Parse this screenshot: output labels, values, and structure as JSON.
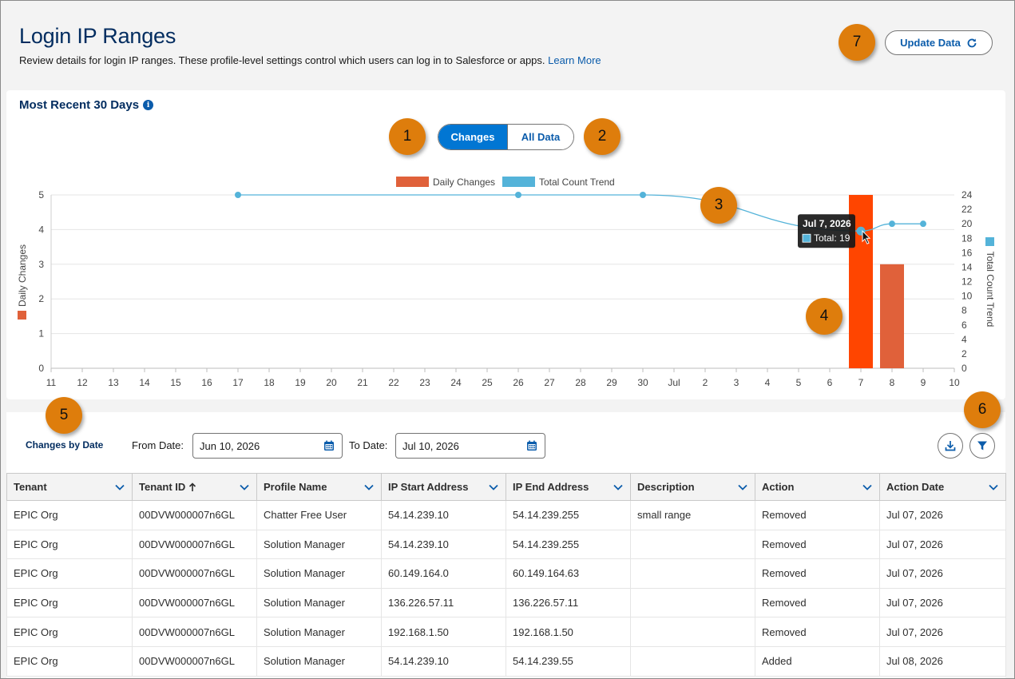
{
  "header": {
    "title": "Login IP Ranges",
    "description": "Review details for login IP ranges. These profile-level settings control which users can log in to Salesforce or apps.",
    "learn_more": "Learn More",
    "update_button": "Update Data"
  },
  "callouts": [
    "1",
    "2",
    "3",
    "4",
    "5",
    "6",
    "7"
  ],
  "chart_card": {
    "title": "Most Recent 30 Days",
    "toggle": {
      "active": "Changes",
      "inactive": "All Data"
    }
  },
  "chart_data": {
    "type": "bar",
    "title": "",
    "categories": [
      "11",
      "12",
      "13",
      "14",
      "15",
      "16",
      "17",
      "18",
      "19",
      "20",
      "21",
      "22",
      "23",
      "24",
      "25",
      "26",
      "27",
      "28",
      "29",
      "30",
      "Jul",
      "2",
      "3",
      "4",
      "5",
      "6",
      "7",
      "8",
      "9",
      "10"
    ],
    "series": [
      {
        "name": "Daily Changes",
        "kind": "bar",
        "axis": "left",
        "color": "#e0613a",
        "values": [
          0,
          0,
          0,
          0,
          0,
          0,
          0,
          0,
          0,
          0,
          0,
          0,
          0,
          0,
          0,
          0,
          0,
          0,
          0,
          0,
          0,
          0,
          0,
          0,
          0,
          0,
          5,
          3,
          0,
          0
        ]
      },
      {
        "name": "Total Count Trend",
        "kind": "line",
        "axis": "right",
        "color": "#54b3d9",
        "points": [
          {
            "x": "17",
            "y": 24
          },
          {
            "x": "26",
            "y": 24
          },
          {
            "x": "30",
            "y": 24
          },
          {
            "x": "7",
            "y": 19
          },
          {
            "x": "8",
            "y": 20
          },
          {
            "x": "9",
            "y": 20
          }
        ]
      }
    ],
    "highlight_bar_color": "#ff4500",
    "ylabel": "Daily Changes",
    "y2label": "Total Count Trend",
    "ylim": [
      0,
      5
    ],
    "y_ticks": [
      "0",
      "1",
      "2",
      "3",
      "4",
      "5"
    ],
    "y2lim": [
      0,
      24
    ],
    "y2_ticks": [
      "0",
      "2",
      "4",
      "6",
      "8",
      "10",
      "12",
      "14",
      "16",
      "18",
      "20",
      "22",
      "24"
    ],
    "legend": [
      "Daily Changes",
      "Total Count Trend"
    ],
    "legend_position": "top-center",
    "grid": true,
    "tooltip": {
      "date": "Jul 7, 2026",
      "label": "Total: 19"
    }
  },
  "filters": {
    "section_label": "Changes by Date",
    "from_label": "From Date:",
    "from_value": "Jun 10, 2026",
    "to_label": "To Date:",
    "to_value": "Jul 10, 2026"
  },
  "table": {
    "columns": [
      "Tenant",
      "Tenant ID",
      "Profile Name",
      "IP Start Address",
      "IP End Address",
      "Description",
      "Action",
      "Action Date"
    ],
    "rows": [
      [
        "EPIC Org",
        "00DVW000007n6GL",
        "Chatter Free User",
        "54.14.239.10",
        "54.14.239.255",
        "small range",
        "Removed",
        "Jul 07, 2026"
      ],
      [
        "EPIC Org",
        "00DVW000007n6GL",
        "Solution Manager",
        "54.14.239.10",
        "54.14.239.255",
        "",
        "Removed",
        "Jul 07, 2026"
      ],
      [
        "EPIC Org",
        "00DVW000007n6GL",
        "Solution Manager",
        "60.149.164.0",
        "60.149.164.63",
        "",
        "Removed",
        "Jul 07, 2026"
      ],
      [
        "EPIC Org",
        "00DVW000007n6GL",
        "Solution Manager",
        "136.226.57.11",
        "136.226.57.11",
        "",
        "Removed",
        "Jul 07, 2026"
      ],
      [
        "EPIC Org",
        "00DVW000007n6GL",
        "Solution Manager",
        "192.168.1.50",
        "192.168.1.50",
        "",
        "Removed",
        "Jul 07, 2026"
      ],
      [
        "EPIC Org",
        "00DVW000007n6GL",
        "Solution Manager",
        "54.14.239.10",
        "54.14.239.55",
        "",
        "Added",
        "Jul 08, 2026"
      ]
    ]
  },
  "colors": {
    "accent": "#0176d3",
    "link": "#0b5cab",
    "heading": "#032d60",
    "callout": "#de7d0c"
  }
}
